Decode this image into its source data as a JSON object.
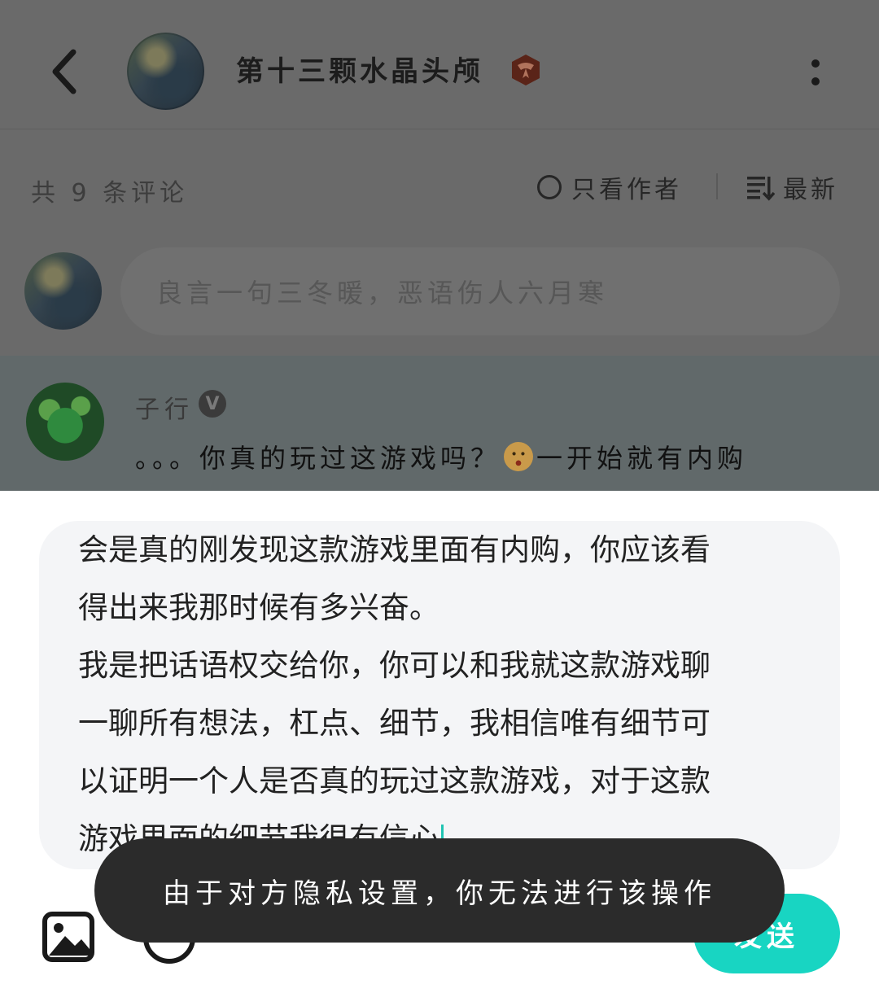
{
  "header": {
    "title": "第十三颗水晶头颅"
  },
  "comments_bar": {
    "count_label": "共 9 条评论",
    "author_only_label": "只看作者",
    "sort_label": "最新"
  },
  "comment_input": {
    "placeholder": "良言一句三冬暖，恶语伤人六月寒"
  },
  "comment": {
    "author": "子行",
    "verified_badge": "V",
    "text_before_emoji": "。。。你真的玩过这游戏吗？",
    "text_after_emoji": "一开始就有内购"
  },
  "composer": {
    "text": "会是真的刚发现这款游戏里面有内购，你应该看\n得出来我那时候有多兴奋。\n我是把话语权交给你，你可以和我就这款游戏聊\n一聊所有想法，杠点、细节，我相信唯有细节可\n以证明一个人是否真的玩过这款游戏，对于这款\n游戏里面的细节我很有信心"
  },
  "actions": {
    "send_label": "发送"
  },
  "toast": {
    "message": "由于对方隐私设置，你无法进行该操作"
  },
  "colors": {
    "accent": "#18d5c2",
    "cursor": "#1fc4b2"
  }
}
